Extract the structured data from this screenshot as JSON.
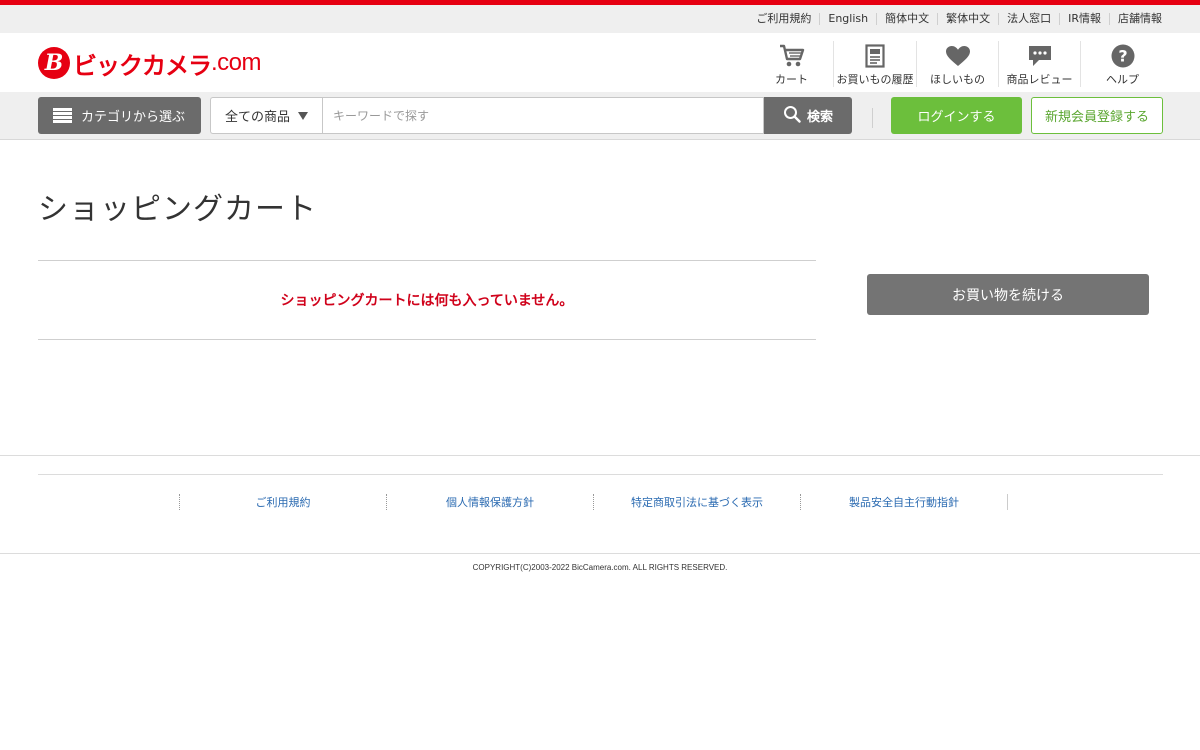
{
  "utility_links": [
    "ご利用規約",
    "English",
    "簡体中文",
    "繁体中文",
    "法人窓口",
    "IR情報",
    "店舗情報"
  ],
  "logo": {
    "text": "ビックカメラ",
    "suffix": ".com",
    "brand_color": "#e60012"
  },
  "header_nav": [
    {
      "label": "カート",
      "icon": "cart-icon"
    },
    {
      "label": "お買いもの履歴",
      "icon": "history-icon"
    },
    {
      "label": "ほしいもの",
      "icon": "heart-icon"
    },
    {
      "label": "商品レビュー",
      "icon": "review-icon"
    },
    {
      "label": "ヘルプ",
      "icon": "help-icon"
    }
  ],
  "search": {
    "category_button": "カテゴリから選ぶ",
    "scope_selected": "全ての商品",
    "placeholder": "キーワードで探す",
    "value": "",
    "button_label": "検索"
  },
  "auth": {
    "login_label": "ログインする",
    "register_label": "新規会員登録する",
    "login_color": "#6cbf3c"
  },
  "main": {
    "title": "ショッピングカート",
    "empty_message": "ショッピングカートには何も入っていません。",
    "empty_color": "#d0021b",
    "continue_label": "お買い物を続ける"
  },
  "footer": {
    "links": [
      "ご利用規約",
      "個人情報保護方針",
      "特定商取引法に基づく表示",
      "製品安全自主行動指針"
    ],
    "copyright": "COPYRIGHT(C)2003-2022 BicCamera.com. ALL RIGHTS RESERVED."
  }
}
